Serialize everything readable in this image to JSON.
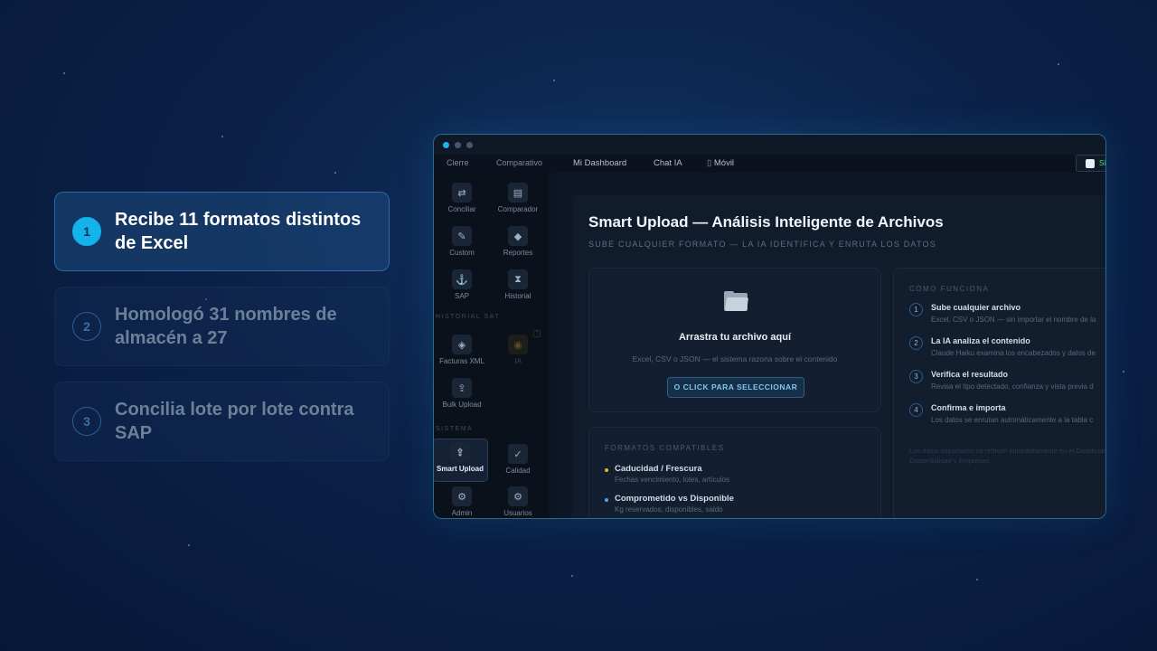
{
  "steps": [
    {
      "number": "1",
      "text": "Recibe 11 formatos distintos de Excel",
      "active": true
    },
    {
      "number": "2",
      "text": "Homologó 31 nombres de almacén a 27",
      "active": false
    },
    {
      "number": "3",
      "text": "Concilia lote por lote contra SAP",
      "active": false
    }
  ],
  "topnav": {
    "cierre": "Cierre",
    "comparativo": "Comparativo",
    "dashboard": "Mi Dashboard",
    "chat": "Chat IA",
    "movil": "Móvil",
    "checkbox_label": "Si"
  },
  "sidebar": {
    "items": [
      {
        "label": "Conciliar",
        "icon": "reconcile-icon"
      },
      {
        "label": "Comparador",
        "icon": "compare-icon"
      },
      {
        "label": "Custom",
        "icon": "custom-icon"
      },
      {
        "label": "Reportes",
        "icon": "reports-icon"
      },
      {
        "label": "SAP",
        "icon": "sap-icon"
      },
      {
        "label": "Historial",
        "icon": "history-icon"
      },
      {
        "label": "Facturas XML",
        "icon": "invoice-icon"
      },
      {
        "label": "IA",
        "icon": "ai-icon"
      },
      {
        "label": "Bulk Upload",
        "icon": "upload-icon"
      },
      {
        "label": "Smart Upload",
        "icon": "smart-upload-icon"
      },
      {
        "label": "Calidad",
        "icon": "quality-icon"
      },
      {
        "label": "Admin",
        "icon": "gear-icon"
      },
      {
        "label": "Usuarios",
        "icon": "users-icon"
      }
    ],
    "section_historial": "HISTORIAL SAT",
    "section_sistema": "SISTEMA",
    "badge": "!"
  },
  "main": {
    "title": "Smart Upload — Análisis Inteligente de Archivos",
    "subtitle": "SUBE CUALQUIER FORMATO — LA IA IDENTIFICA Y ENRUTA LOS DATOS",
    "drop": {
      "title": "Arrastra tu archivo aquí",
      "subtitle": "Excel, CSV o JSON — el sistema razona sobre el contenido",
      "button": "O CLICK PARA SELECCIONAR"
    },
    "formats": {
      "title": "FORMATOS COMPATIBLES",
      "items": [
        {
          "name": "Caducidad / Frescura",
          "desc": "Fechas vencimiento, lotes, artículos",
          "color": "#f0b429"
        },
        {
          "name": "Comprometido vs Disponible",
          "desc": "Kg reservados, disponibles, saldo",
          "color": "#3fa9f5"
        }
      ]
    },
    "how": {
      "title": "CÓMO FUNCIONA",
      "steps": [
        {
          "num": "1",
          "name": "Sube cualquier archivo",
          "desc": "Excel, CSV o JSON — sin importar el nombre de la"
        },
        {
          "num": "2",
          "name": "La IA analiza el contenido",
          "desc": "Claude Haiku examina los encabezados y datos de"
        },
        {
          "num": "3",
          "name": "Verifica el resultado",
          "desc": "Revisa el tipo detectado, confianza y vista previa d"
        },
        {
          "num": "4",
          "name": "Confirma e importa",
          "desc": "Los datos se enrutan automáticamente a la tabla c"
        }
      ],
      "note": "Los datos importados se reflejan inmediatamente en el Dashboard, Disponibilidad y Empresas."
    }
  }
}
